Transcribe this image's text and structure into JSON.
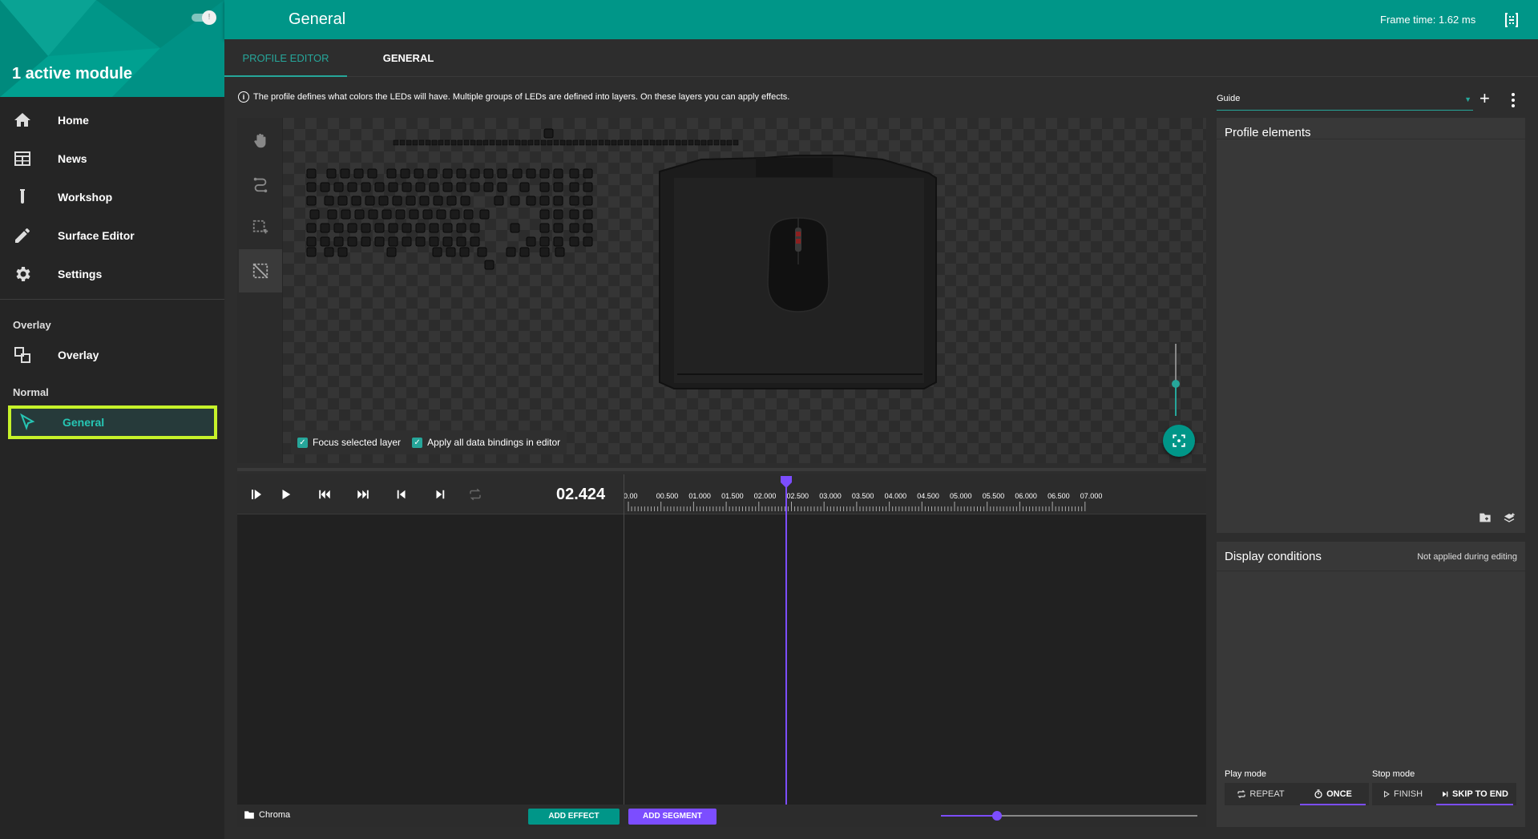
{
  "sidebar": {
    "active_modules": "1 active module",
    "nav": [
      {
        "label": "Home",
        "icon": "home-icon"
      },
      {
        "label": "News",
        "icon": "newspaper-icon"
      },
      {
        "label": "Workshop",
        "icon": "test-tube-icon"
      },
      {
        "label": "Surface Editor",
        "icon": "pencil-icon"
      },
      {
        "label": "Settings",
        "icon": "gear-icon"
      }
    ],
    "overlay_section": "Overlay",
    "overlay_item": "Overlay",
    "normal_section": "Normal",
    "general_item": "General"
  },
  "topbar": {
    "title": "General",
    "frame_time": "Frame time: 1.62 ms"
  },
  "tabs": [
    {
      "label": "PROFILE EDITOR",
      "active": true
    },
    {
      "label": "GENERAL",
      "active": false
    }
  ],
  "info_text": "The profile defines what colors the LEDs will have. Multiple groups of LEDs are defined into layers. On these layers you can apply effects.",
  "visualizer": {
    "focus_layer": "Focus selected layer",
    "apply_bindings": "Apply all data bindings in editor"
  },
  "timeline": {
    "current_time": "02.424",
    "ticks": [
      "0.00",
      "00.500",
      "01.000",
      "01.500",
      "02.000",
      "02.500",
      "03.000",
      "03.500",
      "04.000",
      "04.500",
      "05.000",
      "05.500",
      "06.000",
      "06.500",
      "07.000"
    ],
    "playhead_seconds": 2.424,
    "layer_name": "Chroma",
    "add_effect": "ADD EFFECT",
    "add_segment": "ADD SEGMENT"
  },
  "right": {
    "guide_value": "Guide",
    "profile_elements": "Profile elements",
    "display_conditions": "Display conditions",
    "dc_note": "Not applied during editing",
    "play_mode_label": "Play mode",
    "stop_mode_label": "Stop mode",
    "repeat": "REPEAT",
    "once": "ONCE",
    "finish": "FINISH",
    "skip_to_end": "SKIP TO END"
  },
  "colors": {
    "accent": "#009688",
    "teal_text": "#26a69a",
    "purple": "#7c4dff",
    "highlight": "#c6f22a"
  }
}
